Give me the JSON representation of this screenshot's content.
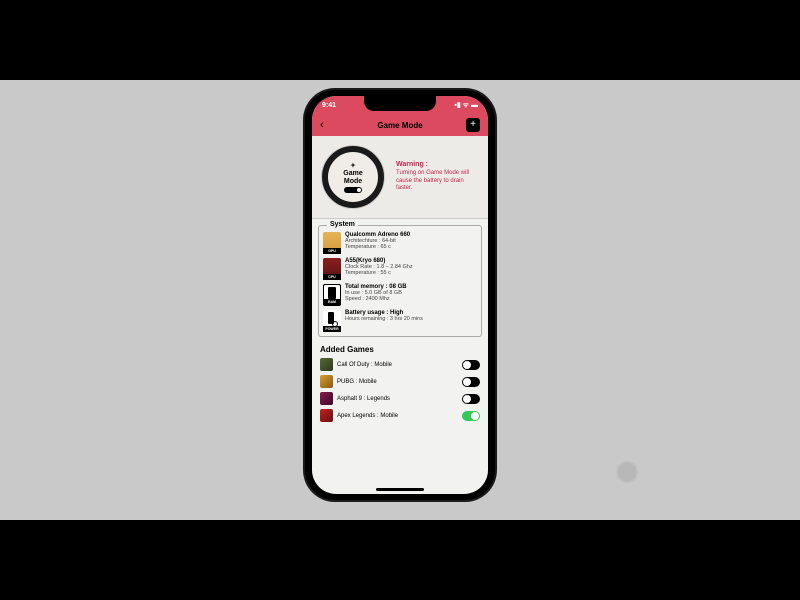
{
  "status": {
    "time": "9:41",
    "indicators": "▪▮ ᯤ ▬"
  },
  "nav": {
    "title": "Game Mode",
    "back": "‹",
    "add": "+"
  },
  "hero": {
    "badge_line1": "Game",
    "badge_line2": "Mode",
    "warning_title": "Warning :",
    "warning_text": "Turning on Game Mode will cause the battery to drain faster."
  },
  "section_system": {
    "legend": "System",
    "items": [
      {
        "icon_label": "GPU",
        "title": "Qualcomm Adreno 660",
        "line1": "Architechture : 64-bit",
        "line2": "Temperature : 65 c"
      },
      {
        "icon_label": "CPU",
        "title": "A55(Kryo 680)",
        "line1": "Clock Rate : 1.8 – 2.84 Ghz",
        "line2": "Temperature : 55 c"
      },
      {
        "icon_label": "RAM",
        "title": "Total memory : 08 GB",
        "line1": "In use : 5.0 GB of 8 GB",
        "line2": "Speed : 2400 Mhz"
      },
      {
        "icon_label": "POWER",
        "title": "Battery usage : High",
        "line1": "Hours remaining : 3 hrs 20 mins",
        "line2": ""
      }
    ]
  },
  "games": {
    "header": "Added Games",
    "items": [
      {
        "name": "Call Of Duty : Mobile",
        "on": false
      },
      {
        "name": "PUBG : Mobile",
        "on": false
      },
      {
        "name": "Asphalt 9 : Legends",
        "on": false
      },
      {
        "name": "Apex Legends : Mobile",
        "on": true
      }
    ]
  }
}
